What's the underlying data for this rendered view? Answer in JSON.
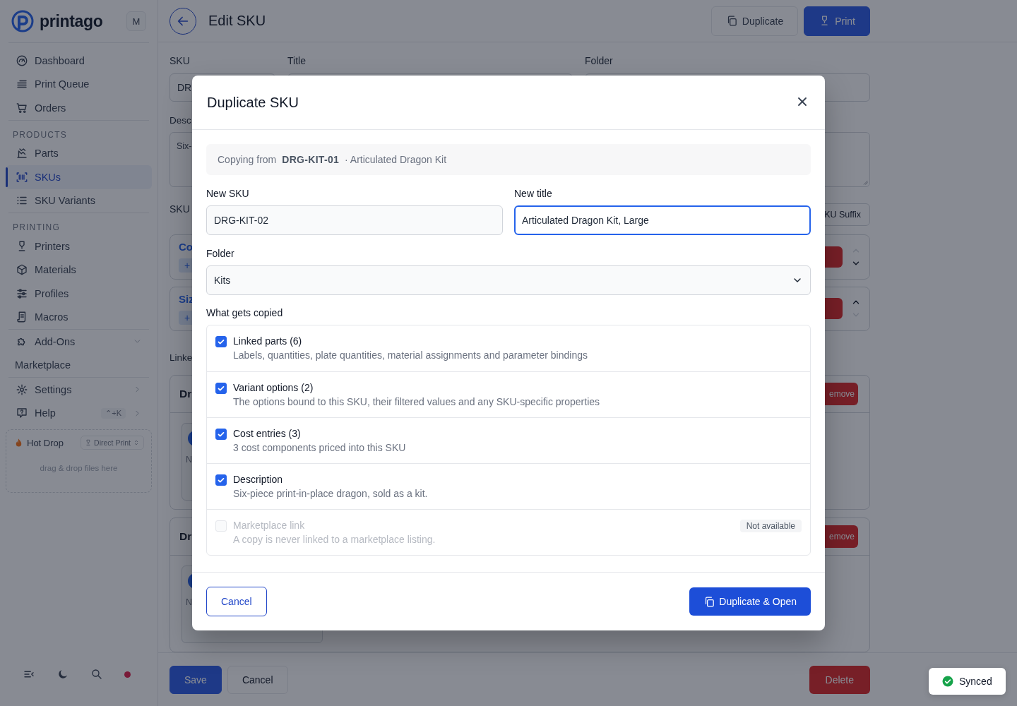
{
  "sidebar": {
    "brand": "printago",
    "workspace_badge": "M",
    "sections": [
      {
        "items": [
          {
            "label": "Dashboard",
            "selected": false
          },
          {
            "label": "Print Queue",
            "selected": false
          },
          {
            "label": "Orders",
            "selected": false
          }
        ]
      },
      {
        "heading": "PRODUCTS",
        "items": [
          {
            "label": "Parts",
            "selected": false
          },
          {
            "label": "SKUs",
            "selected": true
          },
          {
            "label": "SKU Variants",
            "selected": false
          }
        ]
      },
      {
        "heading": "PRINTING",
        "items": [
          {
            "label": "Printers",
            "selected": false
          },
          {
            "label": "Materials",
            "selected": false
          },
          {
            "label": "Profiles",
            "selected": false
          },
          {
            "label": "Macros",
            "selected": false
          }
        ]
      },
      {
        "items": [
          {
            "label": "Add-Ons",
            "selected": false
          },
          {
            "label": "Marketplace",
            "selected": false
          }
        ]
      },
      {
        "items": [
          {
            "label": "Settings",
            "selected": false
          },
          {
            "label": "Help",
            "shortcut": "⌃+K",
            "selected": false
          }
        ]
      }
    ],
    "hot_drop": {
      "title": "Hot Drop",
      "mode": "Direct Print",
      "hint": "drag & drop files here"
    }
  },
  "header": {
    "title": "Edit SKU",
    "buttons": [
      {
        "label": "Duplicate",
        "kind": "secondary"
      },
      {
        "label": "Print",
        "kind": "primary"
      }
    ]
  },
  "form": {
    "labels": [
      "SKU",
      "Title",
      "Folder"
    ],
    "sku_value": "DR",
    "description_label": "Desc",
    "description_value": "Six-",
    "variants_label": "SKU",
    "suffix_button": "KU Suffix",
    "option_cards": [
      {
        "title": "Co",
        "add": "+",
        "can_move_up": false,
        "can_move_down": true
      },
      {
        "title": "Siz",
        "add": "+",
        "can_move_up": true,
        "can_move_down": false
      }
    ],
    "linked_label": "Linke",
    "part_cards": [
      {
        "title": "Dr",
        "remove": "emove",
        "note": "N"
      },
      {
        "title": "Dr",
        "remove": "emove",
        "note": "N"
      }
    ]
  },
  "bottom_bar": {
    "save": "Save",
    "cancel": "Cancel",
    "delete": "Delete"
  },
  "toast": {
    "text": "Synced"
  },
  "modal": {
    "title": "Duplicate SKU",
    "source": {
      "prefix": "Copying from",
      "sku": "DRG-KIT-01",
      "title": "· Articulated Dragon Kit"
    },
    "new_sku": {
      "label": "New SKU",
      "value": "DRG-KIT-02",
      "focused": false
    },
    "new_title": {
      "label": "New title",
      "value": "Articulated Dragon Kit, Large",
      "focused": true
    },
    "folder": {
      "label": "Folder",
      "value": "Kits"
    },
    "copy_label": "What gets copied",
    "options": [
      {
        "label": "Linked parts (6)",
        "description": "Labels, quantities, plate quantities, material assignments and parameter bindings",
        "checked": true,
        "disabled": false
      },
      {
        "label": "Variant options (2)",
        "description": "The options bound to this SKU, their filtered values and any SKU-specific properties",
        "checked": true,
        "disabled": false
      },
      {
        "label": "Cost entries (3)",
        "description": "3 cost components priced into this SKU",
        "checked": true,
        "disabled": false
      },
      {
        "label": "Description",
        "description": "Six-piece print-in-place dragon, sold as a kit.",
        "checked": true,
        "disabled": false
      },
      {
        "label": "Marketplace link",
        "description": "A copy is never linked to a marketplace listing.",
        "checked": false,
        "disabled": true,
        "badge": "Not available"
      }
    ],
    "cancel": "Cancel",
    "confirm": "Duplicate & Open"
  }
}
